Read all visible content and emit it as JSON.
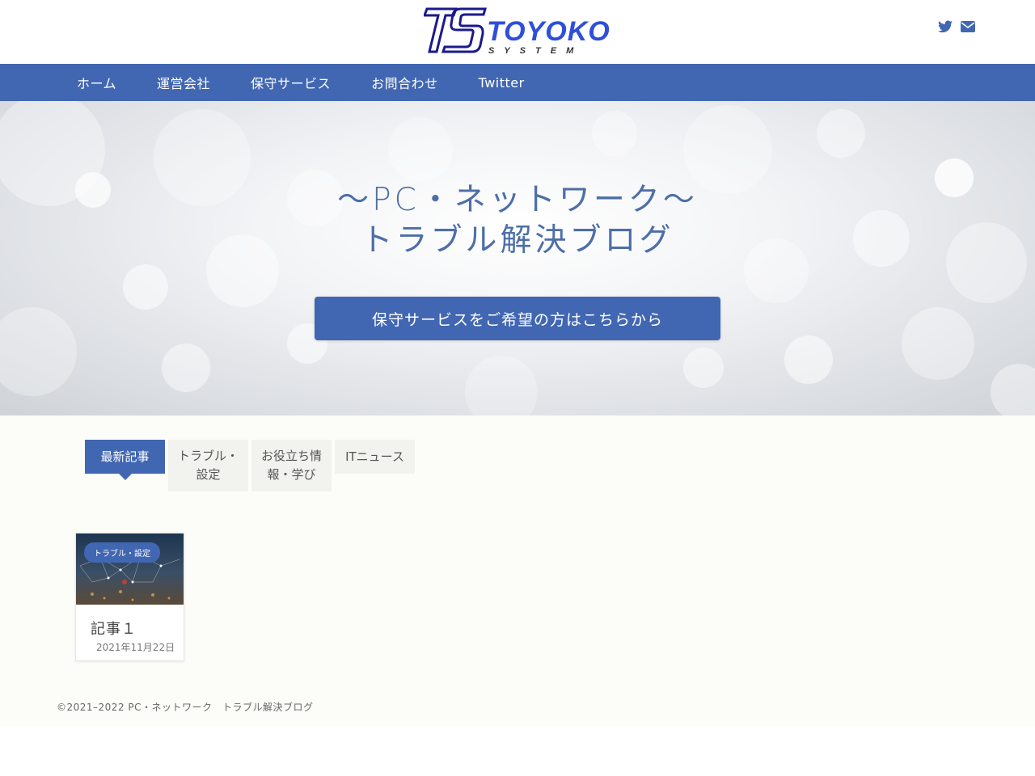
{
  "header": {
    "logo": {
      "mark": "TS",
      "name": "TOYOKO",
      "sub": "SYSTEM"
    },
    "social": [
      {
        "icon": "twitter-icon"
      },
      {
        "icon": "mail-icon"
      }
    ]
  },
  "nav": {
    "items": [
      {
        "label": "ホーム"
      },
      {
        "label": "運営会社"
      },
      {
        "label": "保守サービス"
      },
      {
        "label": "お問合わせ"
      },
      {
        "label": "Twitter"
      }
    ]
  },
  "hero": {
    "title_line1": "～PC・ネットワーク～",
    "title_line2": "トラブル解決ブログ",
    "cta_label": "保守サービスをご希望の方はこちらから"
  },
  "tabs": [
    {
      "label": "最新記事",
      "active": true
    },
    {
      "label": "トラブル・設定",
      "active": false
    },
    {
      "label": "お役立ち情報・学び",
      "active": false
    },
    {
      "label": "ITニュース",
      "active": false
    }
  ],
  "posts": [
    {
      "category": "トラブル・設定",
      "title": "記事１",
      "date": "2021年11月22日"
    }
  ],
  "footer": {
    "copyright": "©2021–2022  PC・ネットワーク　トラブル解決ブログ"
  },
  "colors": {
    "accent": "#4267b2",
    "hero_text": "#4d6fa9",
    "main_bg": "#fcfcf8"
  }
}
